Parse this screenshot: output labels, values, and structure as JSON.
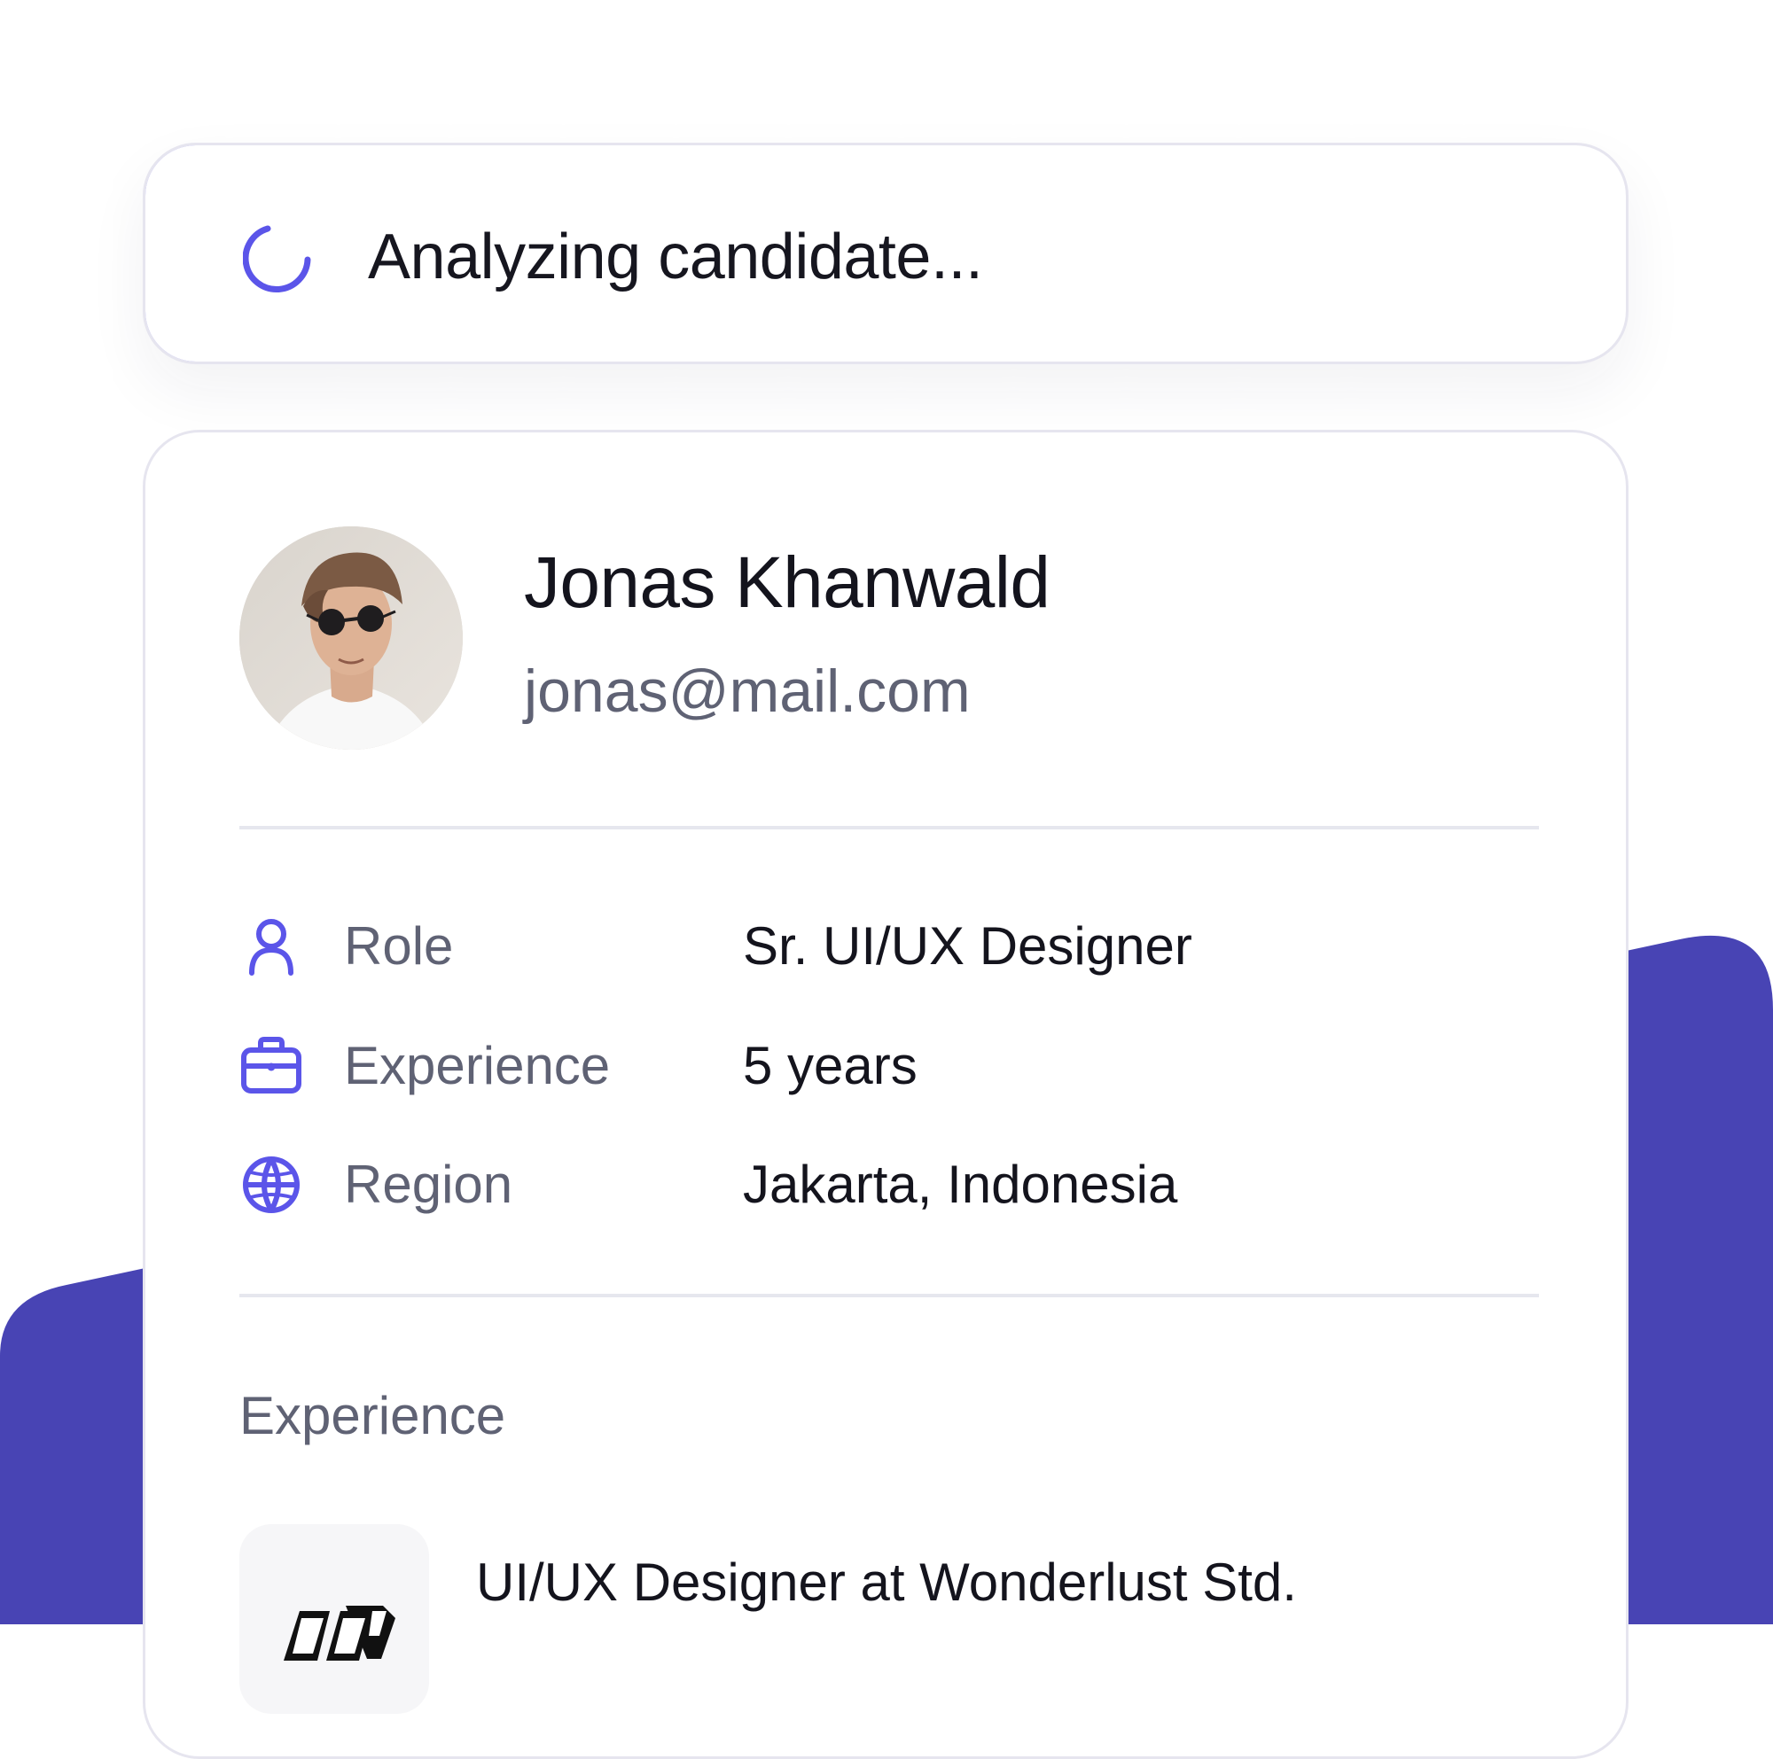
{
  "status": {
    "text": "Analyzing candidate...",
    "icon": "spinner-icon"
  },
  "candidate": {
    "name": "Jonas Khanwald",
    "email": "jonas@mail.com",
    "avatar": "avatar-photo"
  },
  "details": [
    {
      "icon": "user-icon",
      "label": "Role",
      "value": "Sr. UI/UX Designer"
    },
    {
      "icon": "briefcase-icon",
      "label": "Experience",
      "value": "5 years"
    },
    {
      "icon": "globe-icon",
      "label": "Region",
      "value": "Jakarta, Indonesia"
    }
  ],
  "experience_section": {
    "heading": "Experience",
    "items": [
      {
        "logo": "company-logo",
        "title": "UI/UX Designer at Wonderlust Std."
      }
    ]
  },
  "colors": {
    "accent": "#5b55e9",
    "background_shape": "#4844b4",
    "card_border": "#e6e5ef",
    "text_primary": "#14141d",
    "text_secondary": "#5f6274"
  }
}
